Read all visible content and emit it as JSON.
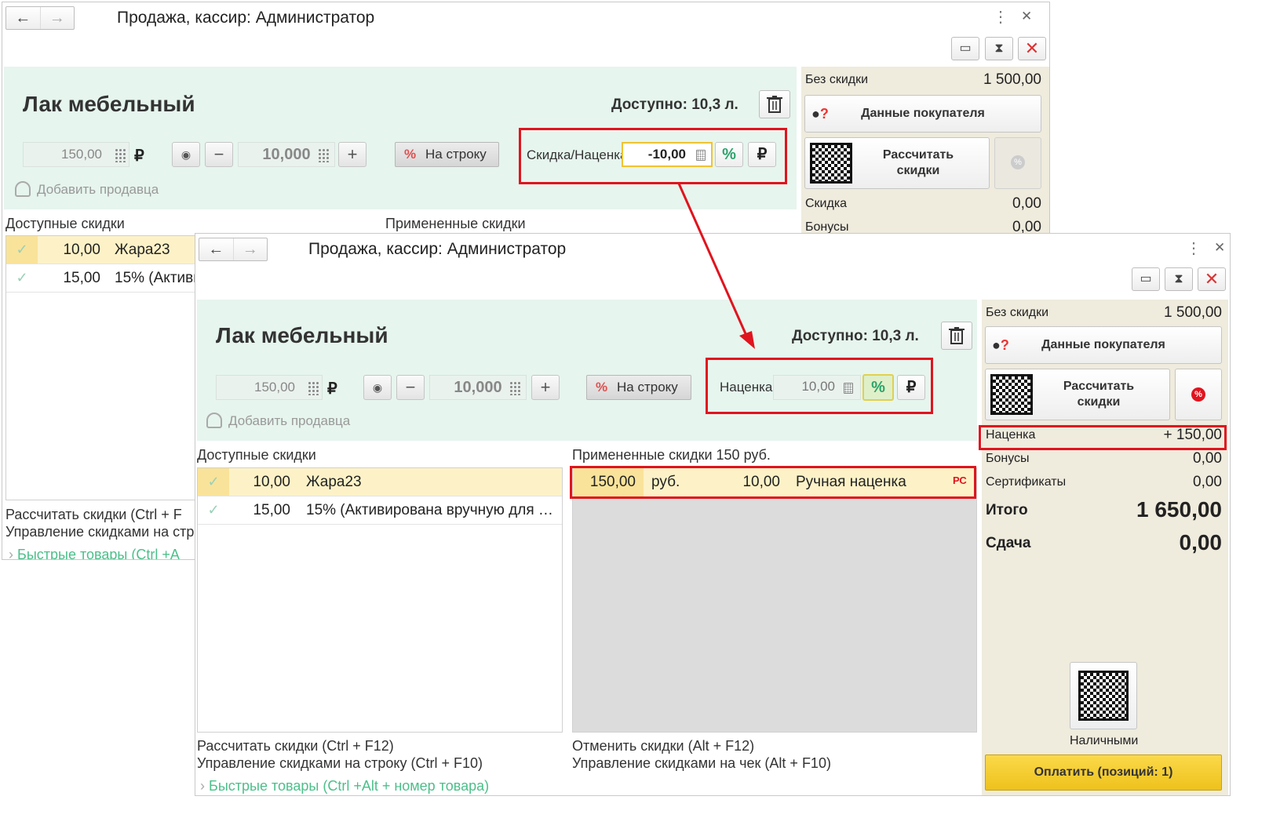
{
  "back_window": {
    "title": "Продажа, кассир: Администратор",
    "product_name": "Лак мебельный",
    "available": "Доступно: 10,3 л.",
    "price": "150,00",
    "currency_symbol": "₽",
    "quantity": "10,000",
    "per_line_button": "На строку",
    "discount_label": "Скидка/Наценка",
    "discount_value": "-10,00",
    "add_seller": "Добавить продавца",
    "available_discounts_header": "Доступные скидки",
    "applied_discounts_header": "Примененные скидки",
    "discounts": [
      {
        "value": "10,00",
        "name": "Жара23"
      },
      {
        "value": "15,00",
        "name": "15% (Активи"
      }
    ],
    "hints": {
      "calc": "Рассчитать скидки (Ctrl + F",
      "manage": "Управление скидками на стр",
      "quick": "Быстрые товары (Ctrl +A"
    },
    "panel": {
      "no_discount_label": "Без скидки",
      "no_discount_value": "1 500,00",
      "customer_button": "Данные покупателя",
      "calc_button": "Рассчитать скидки",
      "discount_label": "Скидка",
      "discount_value": "0,00",
      "bonus_label": "Бонусы",
      "bonus_value": "0,00"
    }
  },
  "front_window": {
    "title": "Продажа, кассир: Администратор",
    "product_name": "Лак мебельный",
    "available": "Доступно: 10,3 л.",
    "price": "150,00",
    "currency_symbol": "₽",
    "quantity": "10,000",
    "per_line_button": "На строку",
    "markup_label": "Наценка",
    "markup_value": "10,00",
    "add_seller": "Добавить продавца",
    "available_discounts_header": "Доступные скидки",
    "applied_discounts_header": "Примененные скидки 150 руб.",
    "discounts": [
      {
        "value": "10,00",
        "name": "Жара23"
      },
      {
        "value": "15,00",
        "name": "15% (Активирована вручную для …"
      }
    ],
    "applied": [
      {
        "amount": "150,00",
        "unit": "руб.",
        "value": "10,00",
        "name": "Ручная наценка",
        "badge": "РС"
      }
    ],
    "hints": {
      "calc": "Рассчитать скидки (Ctrl + F12)",
      "manage_line": "Управление скидками на строку (Ctrl + F10)",
      "cancel": "Отменить скидки (Alt + F12)",
      "manage_check": "Управление скидками на чек (Alt + F10)",
      "quick": "Быстрые товары (Ctrl +Alt + номер товара)"
    },
    "panel": {
      "no_discount_label": "Без скидки",
      "no_discount_value": "1 500,00",
      "customer_button": "Данные покупателя",
      "calc_button": "Рассчитать скидки",
      "markup_label": "Наценка",
      "markup_value": "+ 150,00",
      "bonus_label": "Бонусы",
      "bonus_value": "0,00",
      "cert_label": "Сертификаты",
      "cert_value": "0,00",
      "total_label": "Итого",
      "total_value": "1 650,00",
      "change_label": "Сдача",
      "change_value": "0,00",
      "cash_label": "Наличными",
      "pay_button": "Оплатить (позиций: 1)"
    }
  },
  "colors": {
    "accent_red": "#e0141e",
    "light_green_bg": "#e6f5ee",
    "panel_bg": "#efebdd",
    "pay_yellow": "#f4cc2c"
  }
}
